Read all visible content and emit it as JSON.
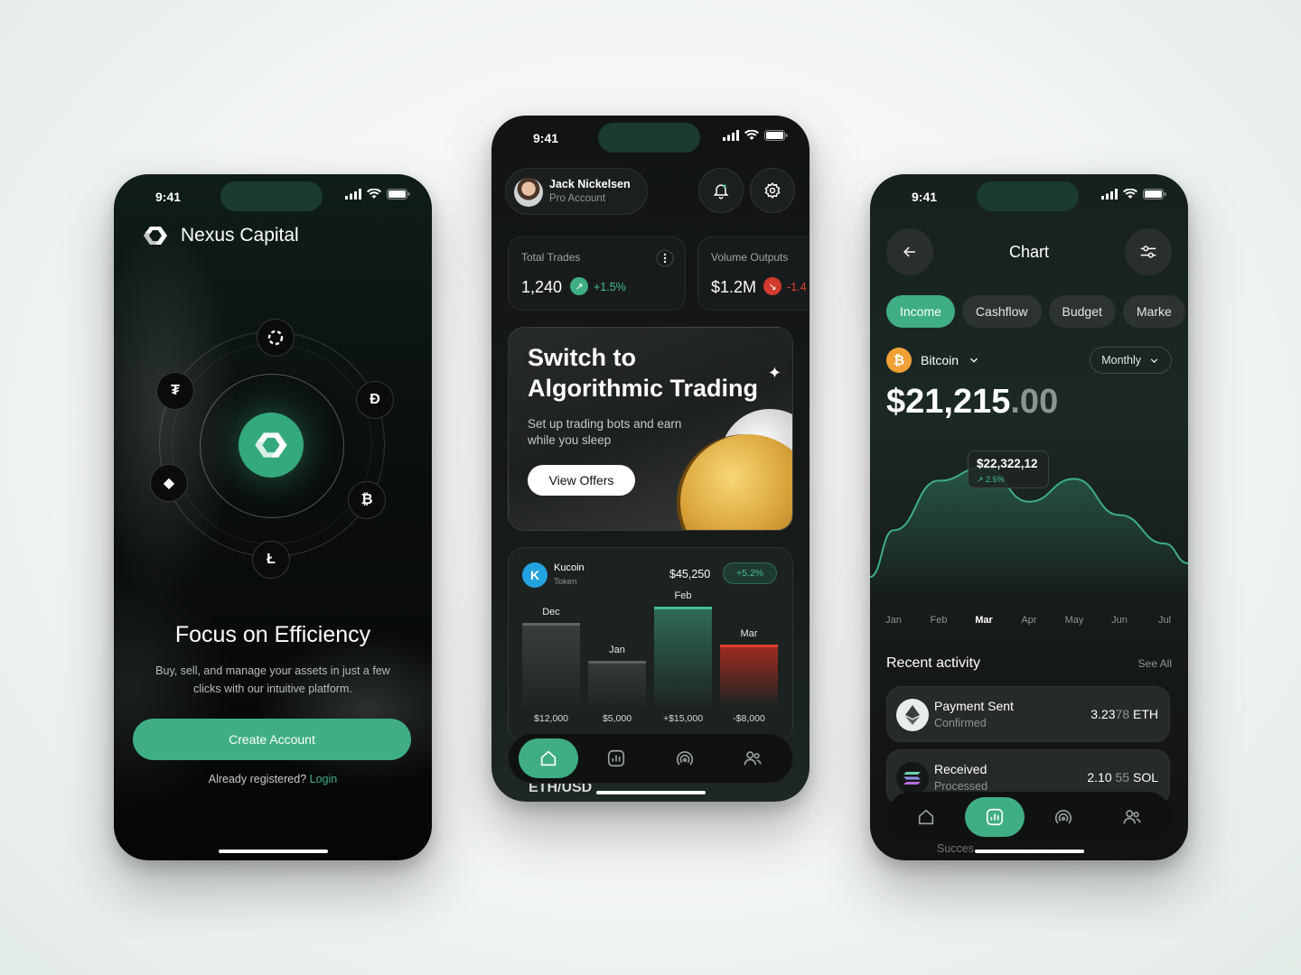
{
  "status": {
    "time": "9:41"
  },
  "onboarding": {
    "brand": "Nexus Capital",
    "headline": "Focus on Efficiency",
    "subtitle": "Buy, sell, and manage your assets in just a few clicks with our intuitive platform.",
    "cta": "Create Account",
    "login_prompt": "Already registered?",
    "login_link": "Login",
    "coins": {
      "tether": "₮",
      "dash": "Đ",
      "bitcoin": "₿",
      "litecoin": "Ł",
      "eth": "◆",
      "polkadot": "◯"
    }
  },
  "dashboard": {
    "user_name": "Jack Nickelsen",
    "user_role": "Pro Account",
    "total_trades": {
      "label": "Total Trades",
      "value": "1,240",
      "change": "+1.5%",
      "arrow": "↗"
    },
    "volume": {
      "label": "Volume Outputs",
      "value": "$1.2M",
      "change": "-1.4",
      "arrow": "↘"
    },
    "promo": {
      "title_line1": "Switch to",
      "title_line2": "Algorithmic Trading",
      "subtitle": "Set up trading bots and earn while you sleep",
      "button": "View Offers",
      "sparkle": "✦"
    },
    "token": {
      "name": "Kucoin",
      "type": "Token",
      "price": "$45,250",
      "change": "+5.2%",
      "logo": "K"
    },
    "chart_data": {
      "type": "bar",
      "categories": [
        "Dec",
        "Jan",
        "Feb",
        "Mar"
      ],
      "values": [
        12000,
        5000,
        15000,
        -8000
      ],
      "value_labels": [
        "$12,000",
        "$5,000",
        "+$15,000",
        "-$8,000"
      ],
      "colors": [
        "#3a3e3f",
        "#363a3b",
        "#2f6a57",
        "#9e2b20"
      ],
      "accent_colors": [
        "#5f6464",
        "#5a5f5f",
        "#45c08f",
        "#e04030"
      ]
    },
    "pair_peek": "ETH/USD",
    "colors": {
      "positive": "#45c08f",
      "negative": "#e04030",
      "accent": "#3fae83"
    }
  },
  "chart_screen": {
    "title": "Chart",
    "tabs": [
      "Income",
      "Cashflow",
      "Budget",
      "Marke"
    ],
    "coin": "Bitcoin",
    "coin_symbol": "₿",
    "period": "Monthly",
    "price_main": "$21,215",
    "price_cents": ".00",
    "tooltip_value": "$22,322,12",
    "tooltip_change": "↗ 2.5%",
    "chart_data": {
      "type": "line",
      "categories": [
        "Jan",
        "Feb",
        "Mar",
        "Apr",
        "May",
        "Jun",
        "Jul"
      ],
      "active_category": "Mar",
      "series": [
        {
          "values": [
            19000,
            21600,
            22322,
            20500,
            21700,
            19800,
            18300
          ]
        }
      ]
    },
    "recent_label": "Recent activity",
    "see_all": "See All",
    "activities": [
      {
        "title": "Payment Sent",
        "status": "Confirmed",
        "amount_main": "3.23",
        "amount_dim": "78",
        "unit": " ETH"
      },
      {
        "title": "Received",
        "status": "Processed",
        "amount_main": "2.10",
        "amount_dim": " 55",
        "unit": " SOL"
      }
    ],
    "peek_text": "Succes"
  }
}
